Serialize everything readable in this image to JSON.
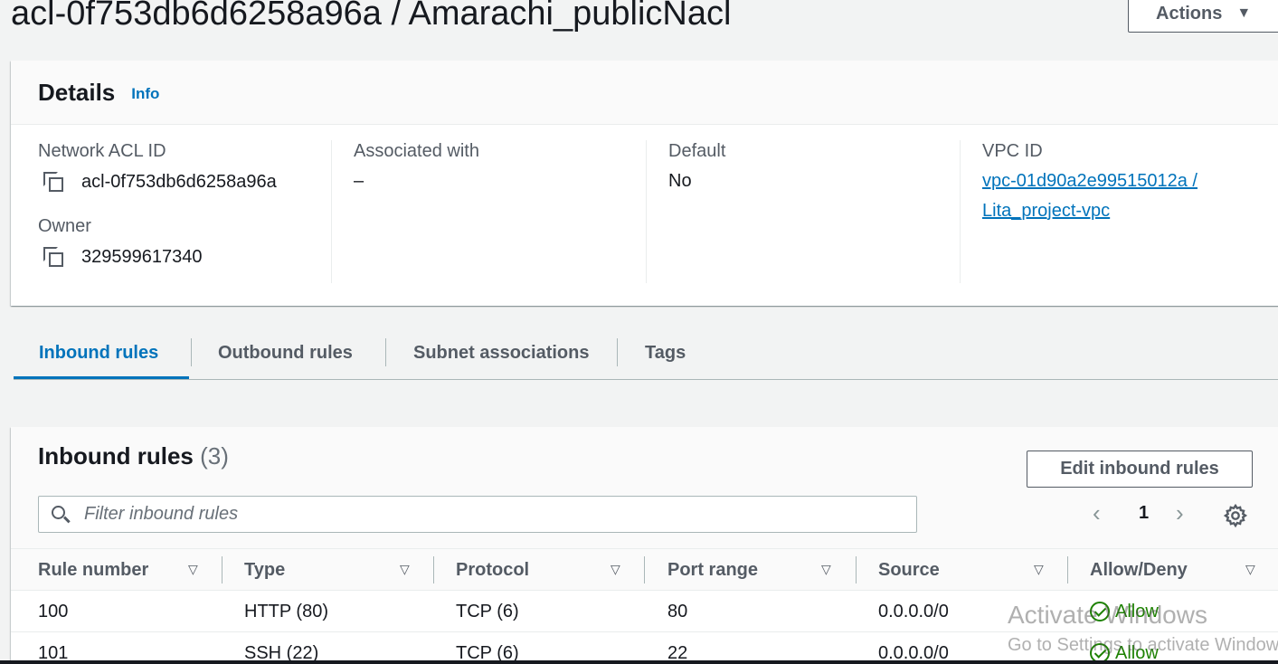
{
  "header": {
    "title": "acl-0f753db6d6258a96a / Amarachi_publicNacl",
    "actions_label": "Actions"
  },
  "details": {
    "title": "Details",
    "info_label": "Info",
    "network_acl_id_label": "Network ACL ID",
    "network_acl_id": "acl-0f753db6d6258a96a",
    "owner_label": "Owner",
    "owner": "329599617340",
    "associated_label": "Associated with",
    "associated_value": "–",
    "default_label": "Default",
    "default_value": "No",
    "vpc_id_label": "VPC ID",
    "vpc_id_line1": "vpc-01d90a2e99515012a /",
    "vpc_id_line2": "Lita_project-vpc"
  },
  "tabs": [
    {
      "label": "Inbound rules",
      "active": true
    },
    {
      "label": "Outbound rules",
      "active": false
    },
    {
      "label": "Subnet associations",
      "active": false
    },
    {
      "label": "Tags",
      "active": false
    }
  ],
  "inbound": {
    "title": "Inbound rules",
    "count": "(3)",
    "edit_label": "Edit inbound rules",
    "filter_placeholder": "Filter inbound rules",
    "page_number": "1",
    "columns": [
      "Rule number",
      "Type",
      "Protocol",
      "Port range",
      "Source",
      "Allow/Deny"
    ],
    "rows": [
      {
        "rule": "100",
        "type": "HTTP (80)",
        "protocol": "TCP (6)",
        "port": "80",
        "source": "0.0.0.0/0",
        "action": "Allow"
      },
      {
        "rule": "101",
        "type": "SSH (22)",
        "protocol": "TCP (6)",
        "port": "22",
        "source": "0.0.0.0/0",
        "action": "Allow"
      }
    ]
  },
  "watermark": {
    "line1": "Activate Windows",
    "line2": "Go to Settings to activate Windows."
  },
  "colors": {
    "link": "#0073bb",
    "allow": "#1d8102",
    "background": "#f2f3f3"
  }
}
